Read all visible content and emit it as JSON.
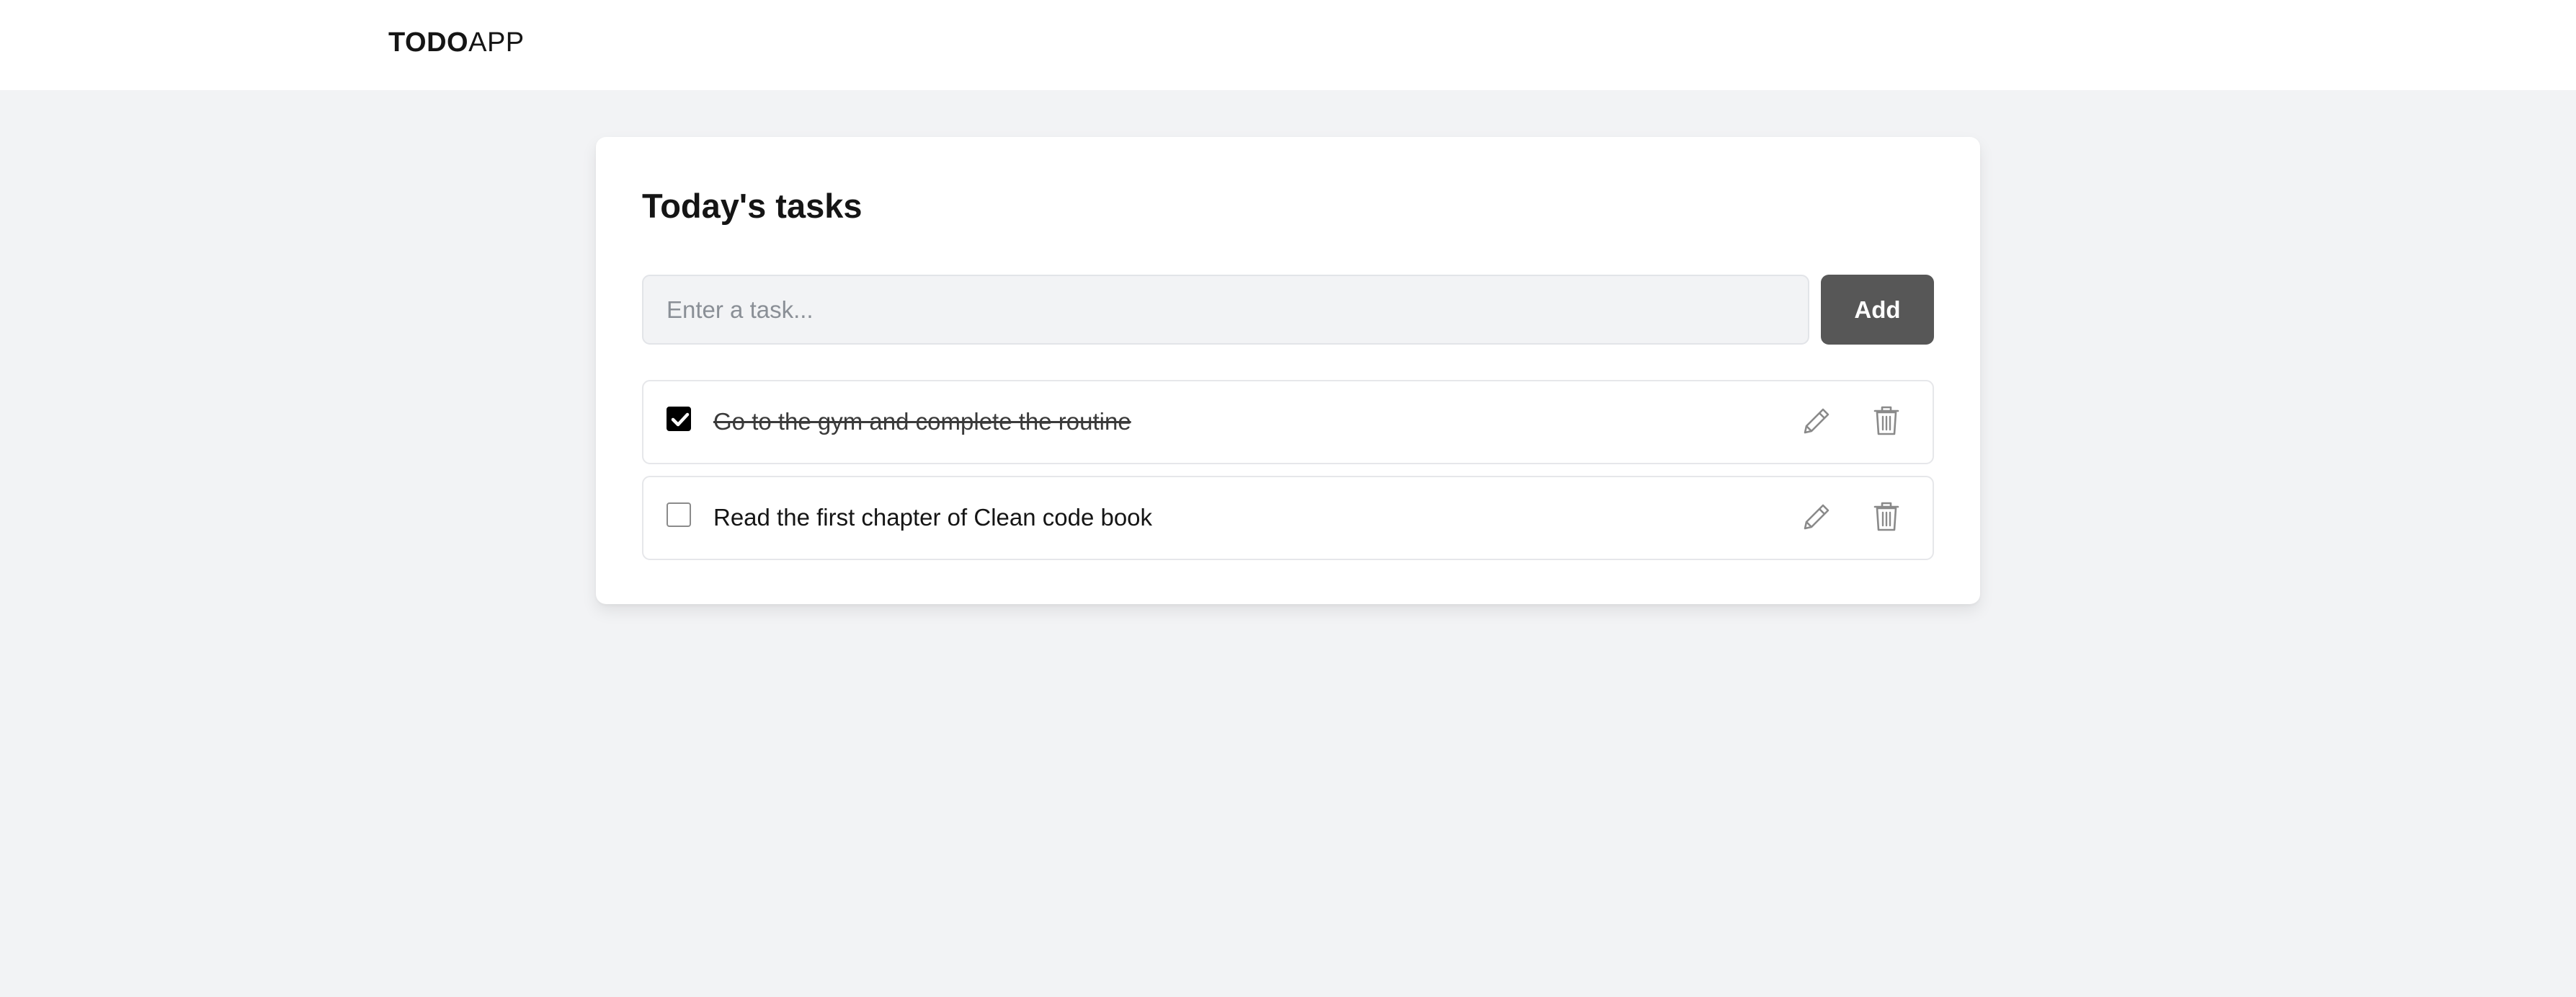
{
  "header": {
    "brand_bold": "TODO",
    "brand_light": "APP"
  },
  "card": {
    "title": "Today's tasks"
  },
  "new_task": {
    "placeholder": "Enter a task...",
    "value": "",
    "add_label": "Add"
  },
  "tasks": [
    {
      "text": "Go to the gym and complete the routine",
      "completed": true
    },
    {
      "text": "Read the first chapter of Clean code book",
      "completed": false
    }
  ],
  "icons": {
    "edit": "pencil-icon",
    "delete": "trash-icon",
    "check": "checkmark-icon"
  },
  "colors": {
    "page_background": "#f2f3f5",
    "card_background": "#ffffff",
    "add_button": "#575757",
    "input_background": "#f2f3f5",
    "checkbox_checked": "#000000",
    "icon_stroke": "#8a8a8a"
  }
}
